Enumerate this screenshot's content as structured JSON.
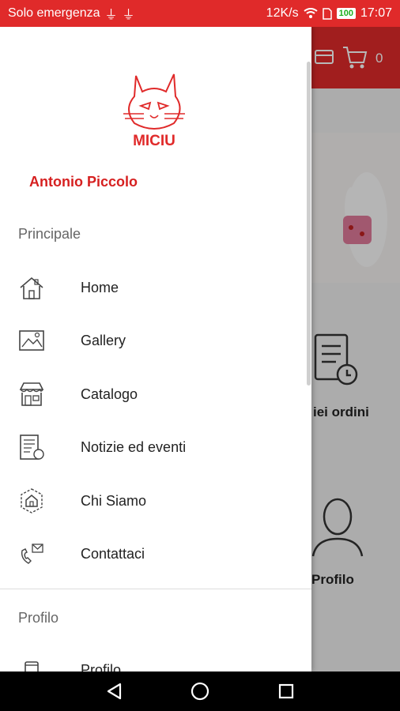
{
  "status_bar": {
    "carrier": "Solo emergenza",
    "speed": "12K/s",
    "battery": "100",
    "time": "17:07"
  },
  "background": {
    "cart_count": "0",
    "orders_label": "iei ordini",
    "profile_label": "Profilo"
  },
  "drawer": {
    "logo_text": "MICIU",
    "user_name": "Antonio Piccolo",
    "sections": [
      {
        "title": "Principale",
        "items": [
          {
            "label": "Home",
            "icon": "home-icon"
          },
          {
            "label": "Gallery",
            "icon": "gallery-icon"
          },
          {
            "label": "Catalogo",
            "icon": "store-icon"
          },
          {
            "label": "Notizie ed eventi",
            "icon": "news-icon"
          },
          {
            "label": "Chi Siamo",
            "icon": "about-icon"
          },
          {
            "label": "Contattaci",
            "icon": "contact-icon"
          }
        ]
      },
      {
        "title": "Profilo",
        "items": [
          {
            "label": "Profilo",
            "icon": "profile-icon"
          }
        ]
      }
    ]
  },
  "colors": {
    "accent": "#e02a2a",
    "user_name": "#d62020"
  }
}
